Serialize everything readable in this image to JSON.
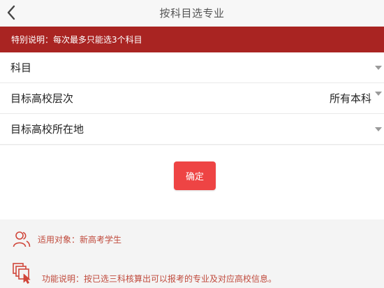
{
  "header": {
    "title": "按科目选专业",
    "back_icon": "chevron-left-icon"
  },
  "notice": {
    "text": "特别说明：每次最多只能选3个科目",
    "background": "#a92422"
  },
  "form": {
    "rows": [
      {
        "label": "科目",
        "value": ""
      },
      {
        "label": "目标高校层次",
        "value": "所有本科"
      },
      {
        "label": "目标高校所在地",
        "value": ""
      }
    ]
  },
  "confirm_button": {
    "label": "确定",
    "color": "#ee4444"
  },
  "info": {
    "audience": {
      "icon": "users-icon",
      "text": "适用对象：新高考学生"
    },
    "description": {
      "icon": "select-cursor-icon",
      "text": "功能说明：按已选三科核算出可以报考的专业及对应高校信息。"
    },
    "accent_color": "#c04a3c"
  }
}
